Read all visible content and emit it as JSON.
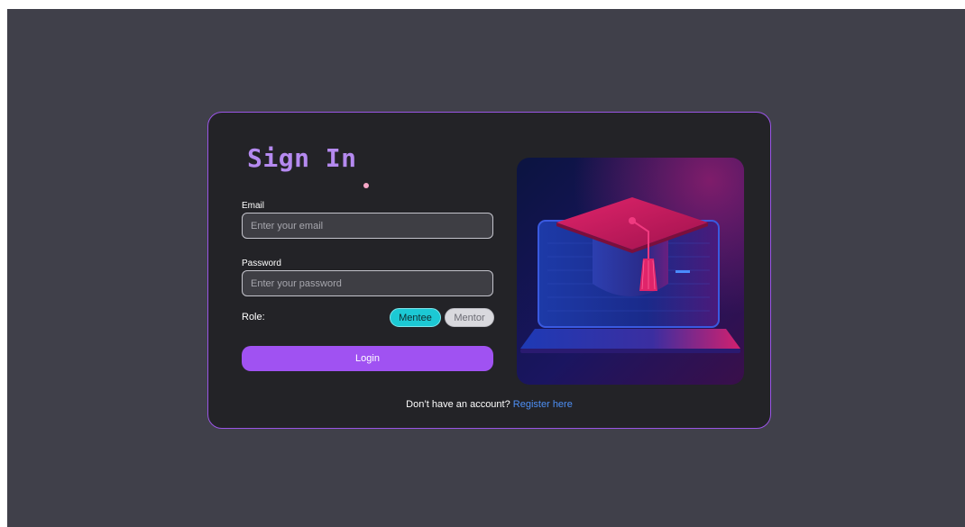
{
  "signin": {
    "title": "Sign In",
    "email_label": "Email",
    "email_placeholder": "Enter your email",
    "password_label": "Password",
    "password_placeholder": "Enter your password",
    "role_label": "Role:",
    "roles": [
      {
        "label": "Mentee",
        "selected": true
      },
      {
        "label": "Mentor",
        "selected": false
      }
    ],
    "login_label": "Login",
    "footer_text": "Don’t have an account?",
    "register_link": "Register here"
  },
  "illustration": {
    "icon": "graduation-cap-laptop"
  },
  "colors": {
    "background": "#40404a",
    "card": "#232327",
    "card_border": "#9a55e6",
    "title": "#b58af0",
    "mentee_selected": "#1cc9d4",
    "mentor_unselected": "#d9d9de",
    "login_button": "#a052f2",
    "link": "#4d8ff5"
  }
}
